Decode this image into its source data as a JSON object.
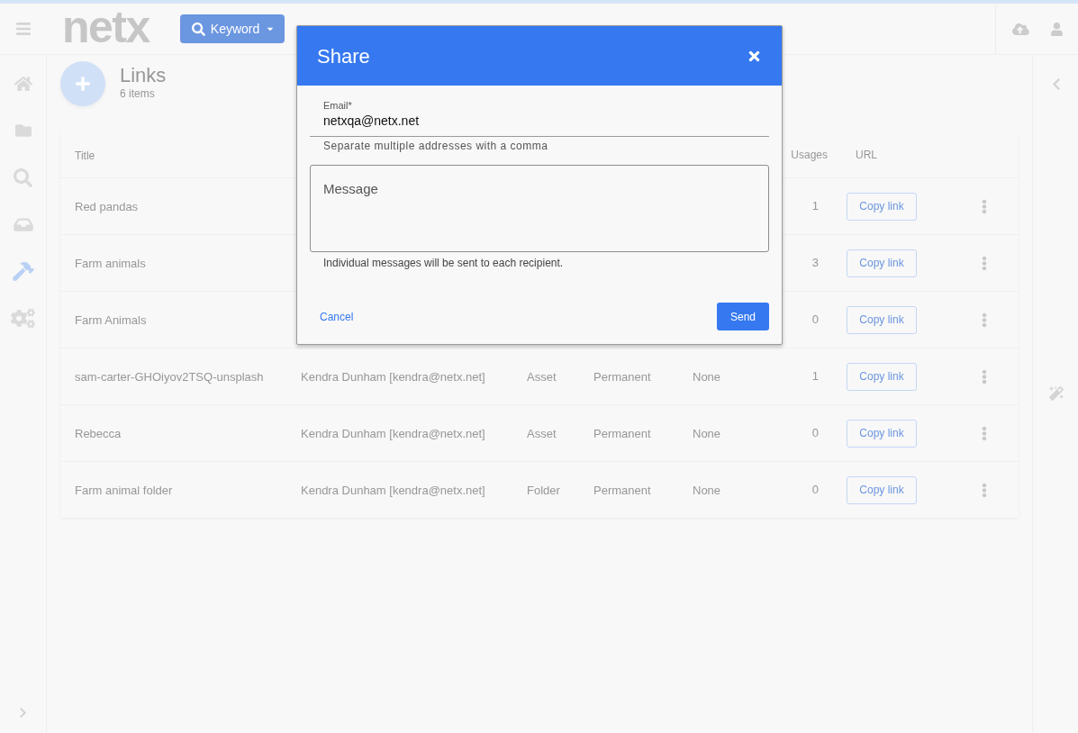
{
  "top_bar": {
    "logo": "netx",
    "search_button": "Keyword"
  },
  "sidebar": {
    "items": [
      {
        "selected": false
      },
      {
        "selected": false
      },
      {
        "selected": false
      },
      {
        "selected": false
      },
      {
        "selected": true
      },
      {
        "selected": false
      }
    ]
  },
  "page": {
    "title": "Links",
    "count": "6 items"
  },
  "table": {
    "columns": {
      "title": "Title",
      "usages": "Usages",
      "url": "URL"
    },
    "rows": [
      {
        "title": "Red pandas",
        "usages": "1",
        "url_button": "Copy link"
      },
      {
        "title": "Farm animals",
        "usages": "3",
        "url_button": "Copy link"
      },
      {
        "title": "Farm Animals",
        "usages": "0",
        "url_button": "Copy link"
      },
      {
        "title": "sam-carter-GHOiyov2TSQ-unsplash",
        "column_2": "Kendra Dunham [kendra@netx.net]",
        "column_3": "Asset",
        "column_4": "Permanent",
        "column_5": "None",
        "usages": "1",
        "url_button": "Copy link"
      },
      {
        "title": "Rebecca",
        "column_2": "Kendra Dunham [kendra@netx.net]",
        "column_3": "Asset",
        "column_4": "Permanent",
        "column_5": "None",
        "usages": "0",
        "url_button": "Copy link"
      },
      {
        "title": "Farm animal folder",
        "column_2": "Kendra Dunham [kendra@netx.net]",
        "column_3": "Folder",
        "column_4": "Permanent",
        "column_5": "None",
        "usages": "0",
        "url_button": "Copy link"
      }
    ]
  },
  "dialog": {
    "title": "Share",
    "email": {
      "label": "Email*",
      "value": "netxqa@netx.net",
      "hint": "Separate multiple addresses with a comma"
    },
    "message": {
      "placeholder": "Message",
      "hint": "Individual messages will be sent to each recipient."
    },
    "buttons": {
      "cancel": "Cancel",
      "send": "Send"
    }
  }
}
